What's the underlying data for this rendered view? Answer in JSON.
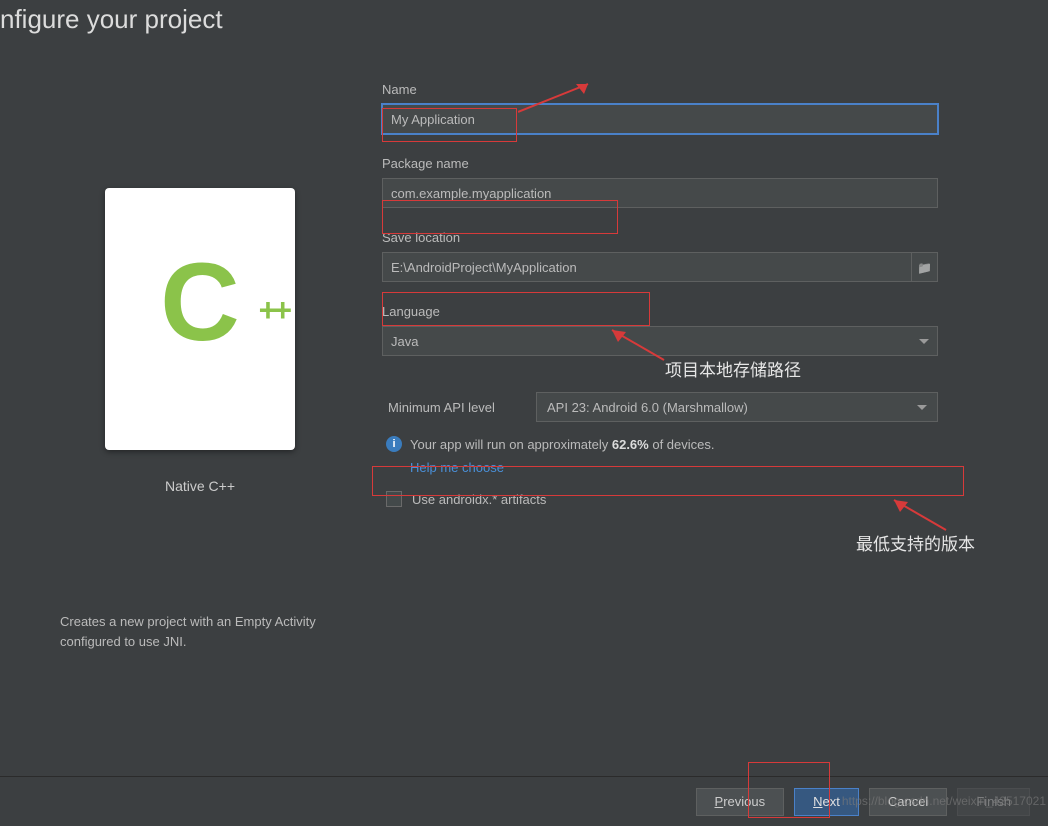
{
  "title": "nfigure your project",
  "template": {
    "name": "Native C++",
    "logo_letter": "C",
    "logo_plus": "++",
    "description": "Creates a new project with an Empty Activity configured to use JNI."
  },
  "form": {
    "name_label": "Name",
    "name_value": "My Application",
    "package_label": "Package name",
    "package_value": "com.example.myapplication",
    "location_label": "Save location",
    "location_value": "E:\\AndroidProject\\MyApplication",
    "language_label": "Language",
    "language_value": "Java",
    "api_label": "Minimum API level",
    "api_value": "API 23: Android 6.0 (Marshmallow)",
    "info_prefix": "Your app will run on approximately ",
    "info_pct": "62.6%",
    "info_suffix": " of devices.",
    "help_link": "Help me choose",
    "androidx_label": "Use androidx.* artifacts"
  },
  "footer": {
    "previous": "Previous",
    "next": "Next",
    "cancel": "Cancel",
    "finish": "Finish"
  },
  "annotations": {
    "save_path": "项目本地存储路径",
    "min_version": "最低支持的版本"
  },
  "watermark": "https://blog.csdn.net/weixin_42517021"
}
